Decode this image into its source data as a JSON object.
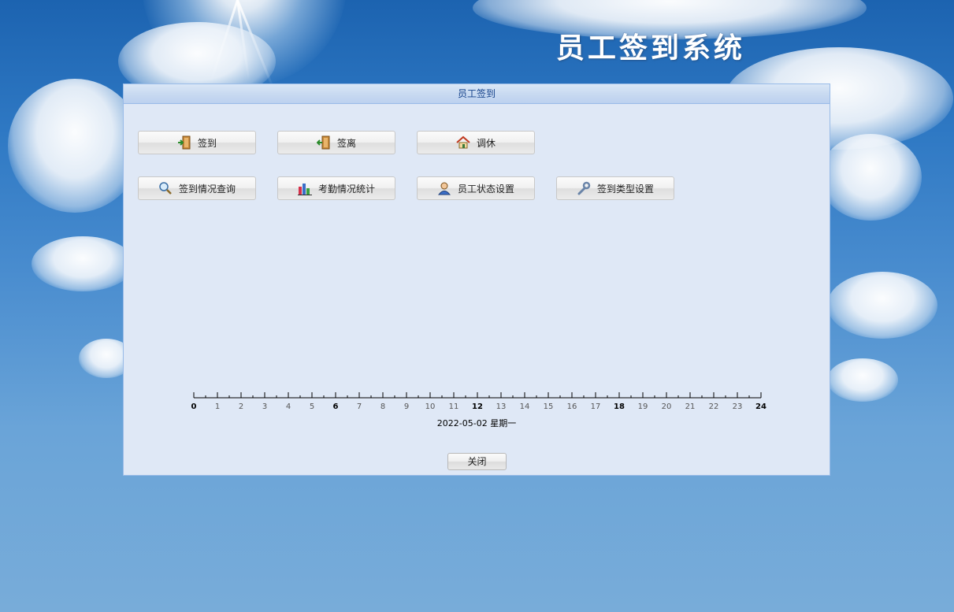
{
  "page": {
    "banner_title": "员工签到系统"
  },
  "panel": {
    "title": "员工签到",
    "buttons_row1": [
      {
        "label": "签到",
        "icon": "sign-in-door-icon"
      },
      {
        "label": "签离",
        "icon": "sign-out-door-icon"
      },
      {
        "label": "调休",
        "icon": "home-icon"
      }
    ],
    "buttons_row2": [
      {
        "label": "签到情况查询",
        "icon": "magnifier-icon"
      },
      {
        "label": "考勤情况统计",
        "icon": "bar-chart-icon"
      },
      {
        "label": "员工状态设置",
        "icon": "user-icon"
      },
      {
        "label": "签到类型设置",
        "icon": "wrench-icon"
      }
    ],
    "close_label": "关闭"
  },
  "timeline": {
    "hours": [
      "0",
      "1",
      "2",
      "3",
      "4",
      "5",
      "6",
      "7",
      "8",
      "9",
      "10",
      "11",
      "12",
      "13",
      "14",
      "15",
      "16",
      "17",
      "18",
      "19",
      "20",
      "21",
      "22",
      "23",
      "24"
    ],
    "major_hours": [
      0,
      6,
      12,
      18,
      24
    ],
    "date_text": "2022-05-02 星期一"
  },
  "colors": {
    "panel_bg": "#dfe8f6",
    "panel_border": "#99bbe8",
    "header_text": "#15428b",
    "sky_top": "#1c63b0",
    "sky_bottom": "#78acd9"
  }
}
